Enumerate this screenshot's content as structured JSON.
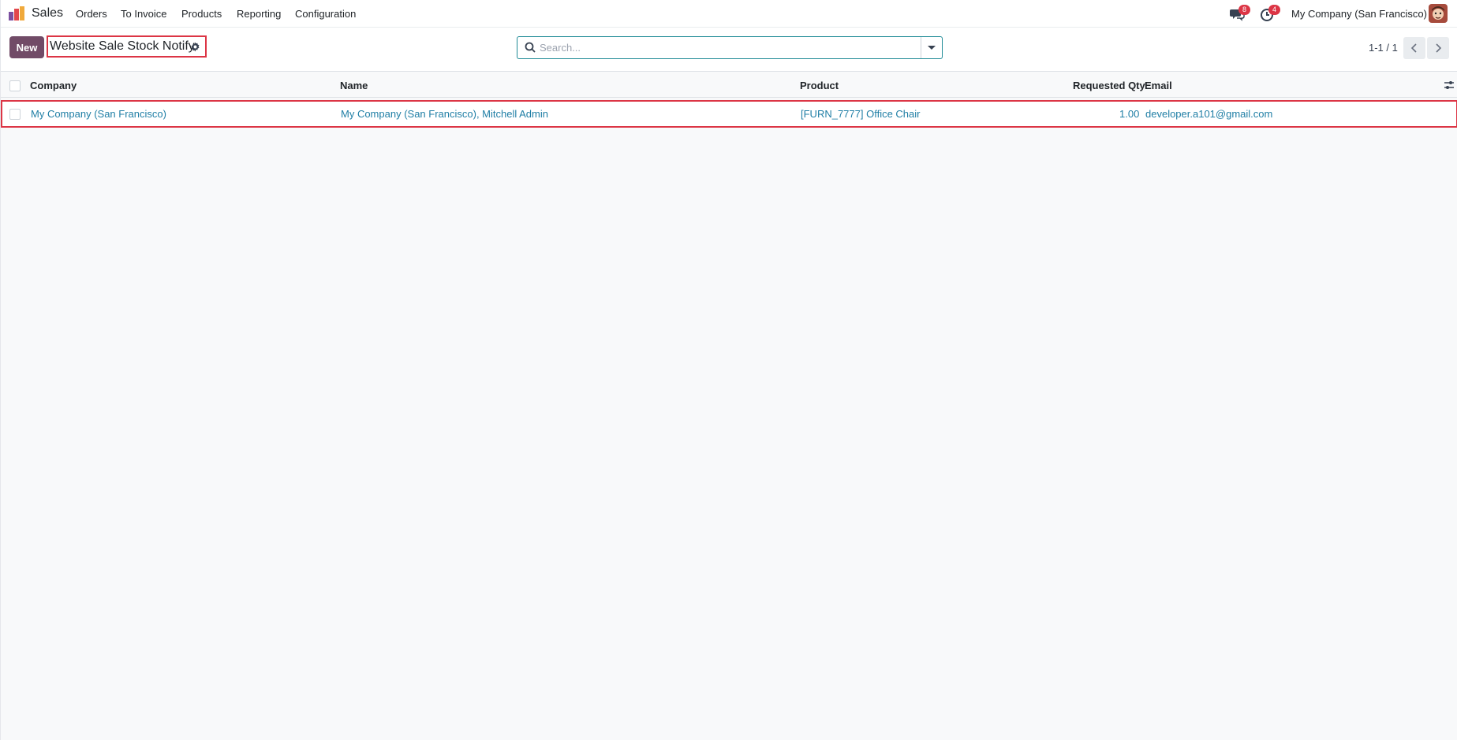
{
  "navbar": {
    "app_name": "Sales",
    "menu": [
      "Orders",
      "To Invoice",
      "Products",
      "Reporting",
      "Configuration"
    ],
    "messages_badge": "8",
    "activities_badge": "4",
    "company": "My Company (San Francisco)",
    "logo_colors": [
      "#f0a93b",
      "#e2474c",
      "#7b4fa0"
    ]
  },
  "control_panel": {
    "new_label": "New",
    "title": "Website Sale Stock Notify",
    "search_placeholder": "Search...",
    "pager": "1-1 / 1"
  },
  "list": {
    "columns": [
      "Company",
      "Name",
      "Product",
      "Requested Qty",
      "Email"
    ],
    "rows": [
      {
        "company": "My Company (San Francisco)",
        "name": "My Company (San Francisco), Mitchell Admin",
        "product": "[FURN_7777] Office Chair",
        "requested_qty": "1.00",
        "email": "developer.a101@gmail.com"
      }
    ]
  },
  "colors": {
    "primary": "#714b67",
    "link": "#1f7ea5",
    "highlight": "#dc3545",
    "search_border": "#1f8b96"
  },
  "icons": [
    "app-logo-icon",
    "chat-icon",
    "clock-icon",
    "avatar",
    "gear-icon",
    "search-icon",
    "caret-down-icon",
    "chevron-left-icon",
    "chevron-right-icon",
    "optional-columns-icon"
  ]
}
